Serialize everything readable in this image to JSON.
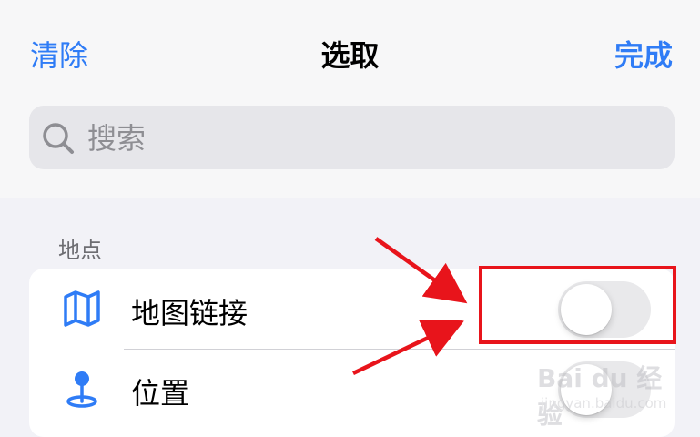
{
  "nav": {
    "clear_label": "清除",
    "title": "选取",
    "done_label": "完成"
  },
  "search": {
    "placeholder": "搜索",
    "icon": "search-icon"
  },
  "section": {
    "label": "地点"
  },
  "rows": [
    {
      "label": "地图链接",
      "icon": "map-icon",
      "toggle_on": false
    },
    {
      "label": "位置",
      "icon": "location-pin-icon",
      "toggle_on": false
    }
  ],
  "watermark": {
    "main": "Bai du 经验",
    "sub": "jingyan.baidu.com"
  },
  "colors": {
    "accent": "#2f7cf6",
    "annotation_red": "#e8141b",
    "toggle_off": "#e9e9eb",
    "background": "#f2f2f7"
  }
}
